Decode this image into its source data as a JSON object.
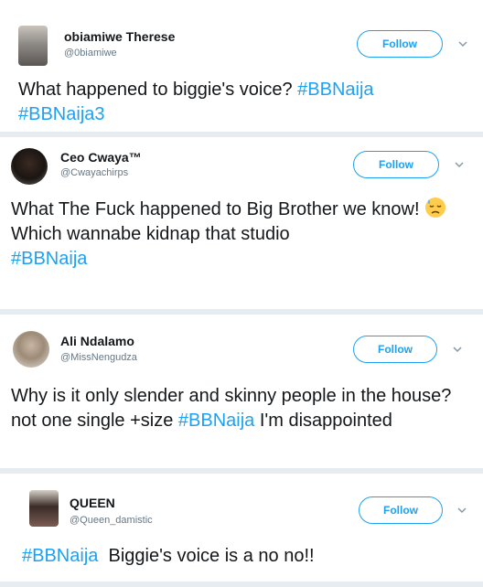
{
  "tweets": [
    {
      "name": "obiamiwe Therese",
      "handle": "@0biamiwe",
      "follow_label": "Follow",
      "text": [
        "What happened to biggie's voice? "
      ],
      "hashtags": [
        "#BBNaija",
        "#BBNaija3"
      ]
    },
    {
      "name": "Ceo Cwaya™",
      "handle": "@Cwayachirps",
      "follow_label": "Follow",
      "text": [
        "What The Fuck happened to Big Brother we know! ",
        "Which wannabe kidnap that studio"
      ],
      "hashtags": [
        "#BBNaija"
      ]
    },
    {
      "name": "Ali Ndalamo",
      "handle": "@MissNengudza",
      "follow_label": "Follow",
      "text": [
        "Why is it only slender and skinny people in the house? not one single +size ",
        " I'm disappointed"
      ],
      "hashtags": [
        "#BBNaija"
      ]
    },
    {
      "name": "QUEEN",
      "handle": "@Queen_damistic",
      "follow_label": "Follow",
      "text": [
        "  Biggie's voice is a no no!!"
      ],
      "hashtags": [
        "#BBNaija"
      ]
    }
  ],
  "colors": {
    "accent": "#1da1f2",
    "text": "#14171a",
    "muted": "#657786",
    "separator": "#e6ecf0"
  }
}
